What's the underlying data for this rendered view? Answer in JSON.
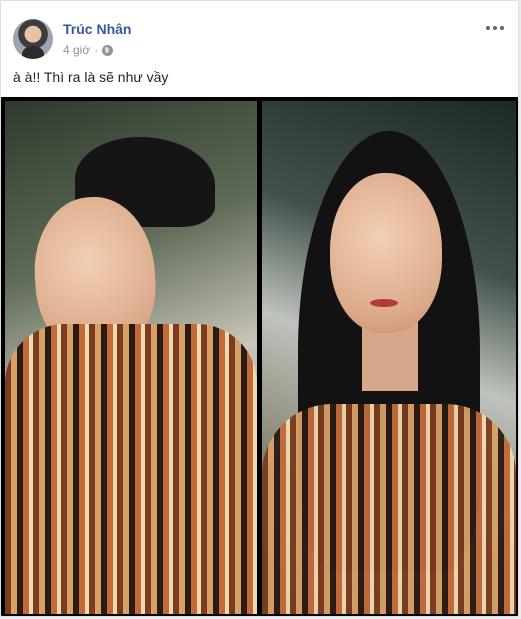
{
  "post": {
    "author": "Trúc Nhân",
    "time": "4 giờ",
    "separator": "·",
    "text": "à à!! Thì ra là sẽ như vầy",
    "icons": {
      "avatar": "profile-avatar",
      "privacy": "globe-icon",
      "more": "more-options-icon"
    }
  },
  "colors": {
    "name_link": "#365899",
    "meta_text": "#90949c",
    "body_text": "#1d2129"
  }
}
